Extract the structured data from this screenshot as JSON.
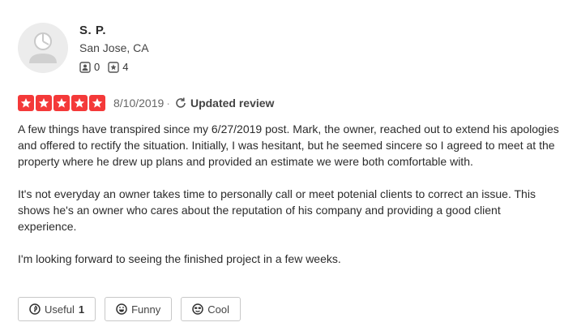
{
  "user": {
    "name": "S. P.",
    "location": "San Jose, CA",
    "friends_count": "0",
    "reviews_count": "4"
  },
  "review": {
    "rating_stars": 5,
    "date": "8/10/2019",
    "separator": "·",
    "updated_label": "Updated review",
    "paragraphs": [
      "A few things have transpired since my 6/27/2019 post. Mark, the owner, reached out to extend his apologies and offered to rectify the situation. Initially, I was hesitant, but he seemed sincere so I agreed to meet at the property where he drew up plans and provided an estimate we were both comfortable with.",
      "It's not everyday an owner takes time to personally call or meet potenial clients to correct an issue. This shows he's an owner who cares about the reputation of his company and providing a good client experience.",
      "I'm looking forward to seeing the finished project in a few weeks."
    ]
  },
  "actions": {
    "useful_label": "Useful",
    "useful_count": "1",
    "funny_label": "Funny",
    "cool_label": "Cool"
  },
  "colors": {
    "star_red": "#f43939",
    "avatar_bg": "#ececec",
    "border": "#c8c8c8"
  }
}
